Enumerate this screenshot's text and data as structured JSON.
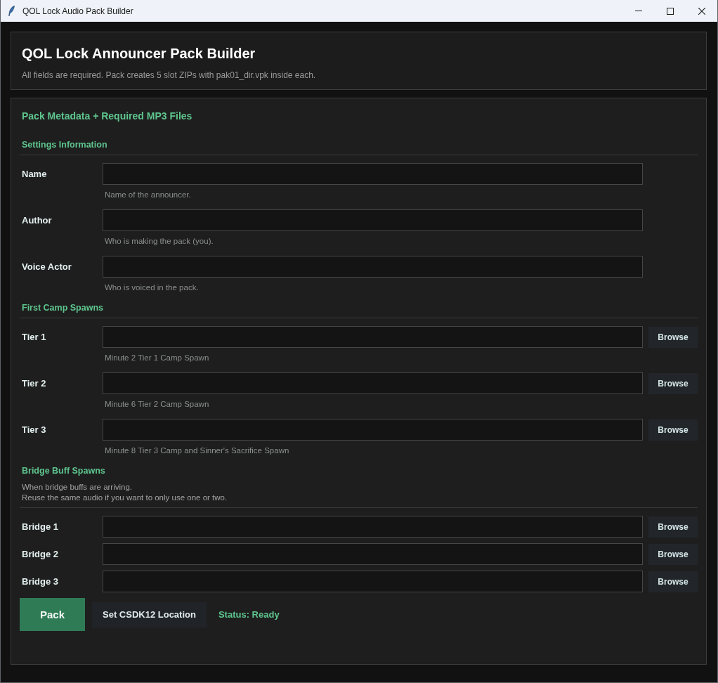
{
  "window": {
    "title": "QOL Lock Audio Pack Builder"
  },
  "header": {
    "title": "QOL Lock Announcer Pack Builder",
    "subtitle": "All fields are required. Pack creates 5 slot ZIPs with pak01_dir.vpk inside each."
  },
  "form": {
    "title": "Pack Metadata + Required MP3 Files",
    "sections": [
      {
        "title": "Settings Information",
        "fields": [
          {
            "kind": "text",
            "label": "Name",
            "help": "Name of the announcer."
          },
          {
            "kind": "text",
            "label": "Author",
            "help": "Who is making the pack (you)."
          },
          {
            "kind": "text",
            "label": "Voice Actor",
            "help": "Who is voiced in the pack."
          }
        ]
      },
      {
        "title": "First Camp Spawns",
        "fields": [
          {
            "kind": "file",
            "label": "Tier 1",
            "help": "Minute 2 Tier 1 Camp Spawn",
            "button": "Browse"
          },
          {
            "kind": "file",
            "label": "Tier 2",
            "help": "Minute 6 Tier 2 Camp Spawn",
            "button": "Browse"
          },
          {
            "kind": "file",
            "label": "Tier 3",
            "help": "Minute 8 Tier 3 Camp and Sinner's Sacrifice Spawn",
            "button": "Browse"
          }
        ]
      },
      {
        "title": "Bridge Buff Spawns",
        "description": [
          "When bridge buffs are arriving.",
          "Reuse the same audio if you want to only use one or two."
        ],
        "fields": [
          {
            "kind": "file",
            "label": "Bridge 1",
            "button": "Browse"
          },
          {
            "kind": "file",
            "label": "Bridge 2",
            "button": "Browse"
          },
          {
            "kind": "file",
            "label": "Bridge 3",
            "button": "Browse"
          }
        ]
      }
    ]
  },
  "actions": {
    "buttons": [
      {
        "kind": "primary",
        "label": "Pack"
      },
      {
        "kind": "secondary",
        "label": "Set CSDK12 Location"
      }
    ],
    "status": "Status: Ready"
  }
}
